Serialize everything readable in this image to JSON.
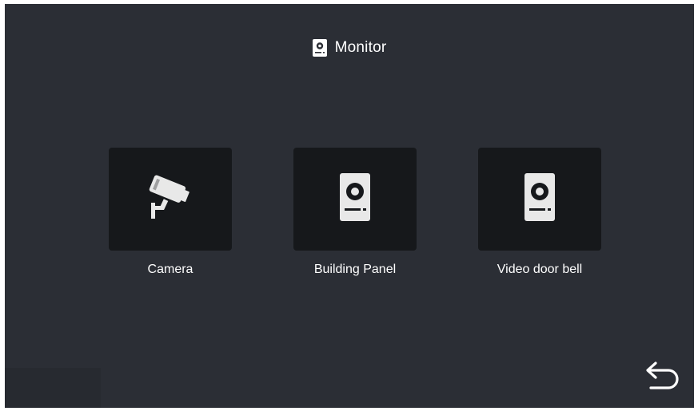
{
  "header": {
    "title": "Monitor",
    "icon": "door-station-icon"
  },
  "tiles": [
    {
      "label": "Camera",
      "icon": "cctv-camera-icon"
    },
    {
      "label": "Building Panel",
      "icon": "door-station-icon"
    },
    {
      "label": "Video door bell",
      "icon": "door-station-icon"
    }
  ],
  "back": {
    "icon": "return-arrow-icon"
  },
  "colors": {
    "background": "#2b2e35",
    "tile": "#16181b",
    "text": "#ffffff",
    "icon": "#e8e8e8"
  }
}
